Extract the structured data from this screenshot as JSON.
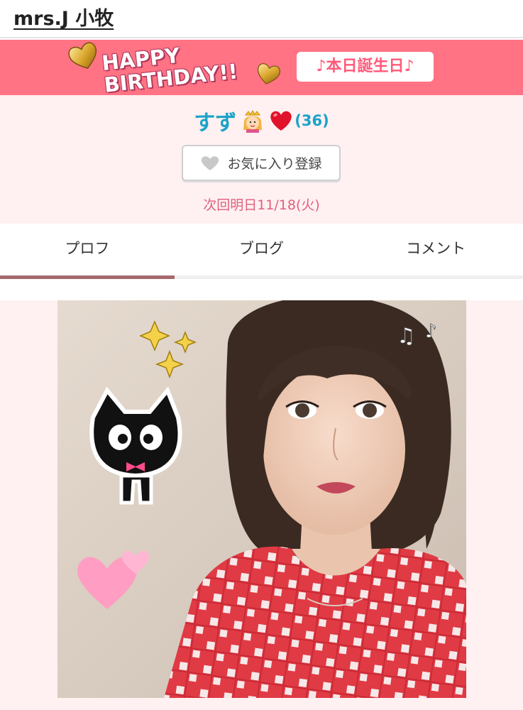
{
  "header": {
    "shop_name": "mrs.J 小牧"
  },
  "banner": {
    "line1": "HAPPY",
    "line2": "BIRTHDAY!!",
    "badge": "♪本日誕生日♪"
  },
  "profile": {
    "name": "すず",
    "count": "(36)",
    "favorite_button": "お気に入り登録",
    "next_shift": "次回明日11/18(火)"
  },
  "tabs": [
    {
      "label": "プロフ",
      "active": true
    },
    {
      "label": "ブログ",
      "active": false
    },
    {
      "label": "コメント",
      "active": false
    }
  ],
  "colors": {
    "banner": "#ff7384",
    "name": "#1aa3c8",
    "next_shift": "#e0607c",
    "tab_indicator": "#a56a6d",
    "profile_bg": "#fff0f2"
  },
  "photo": {
    "description_icon": "profile-photo"
  }
}
